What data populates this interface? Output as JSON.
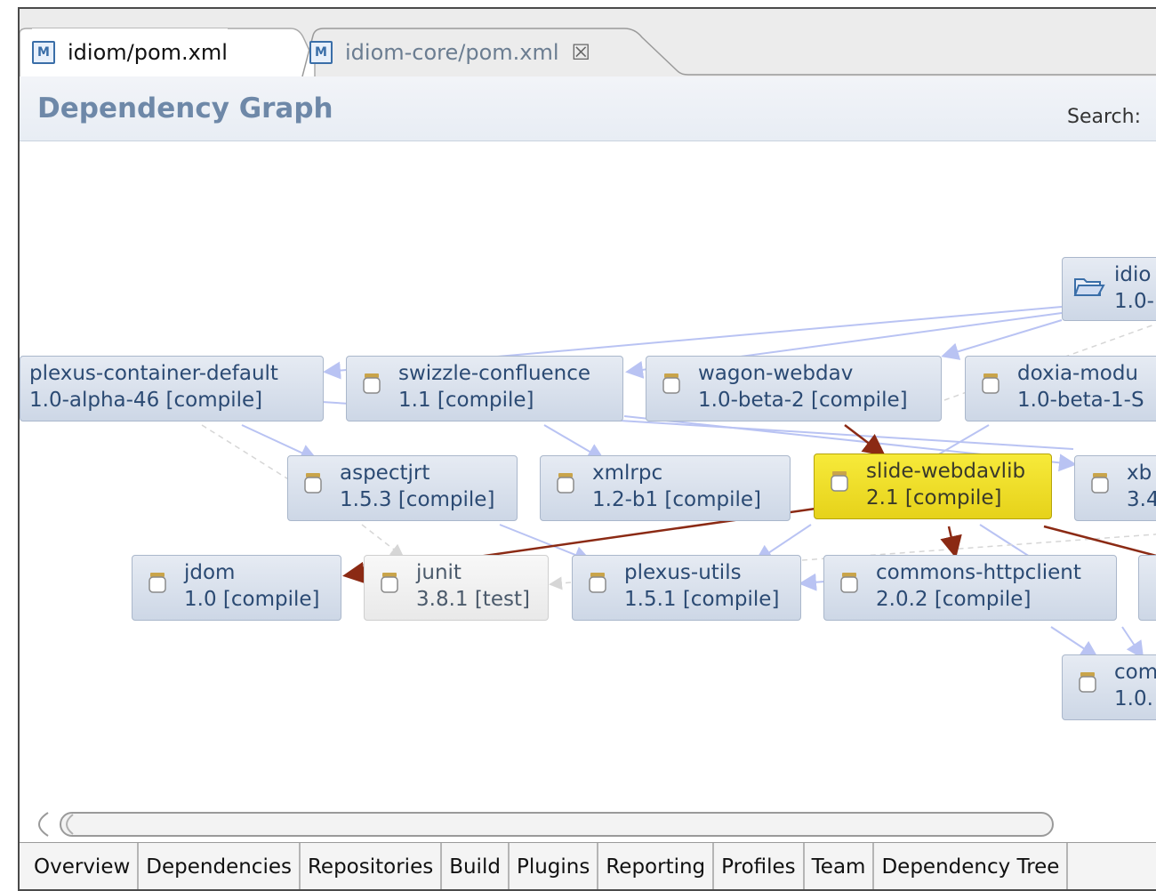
{
  "editor_tabs": [
    {
      "label": "idiom/pom.xml",
      "icon": "maven-pom-icon",
      "active": true
    },
    {
      "label": "idiom-core/pom.xml",
      "icon": "maven-pom-icon",
      "active": false,
      "close_icon": "close-icon"
    }
  ],
  "header": {
    "title": "Dependency Graph",
    "search_label": "Search:"
  },
  "graph": {
    "root_node": {
      "name": "idio",
      "version": "1.0-",
      "icon": "folder-open-icon"
    },
    "nodes": [
      {
        "name": "plexus-container-default",
        "version": "1.0-alpha-46 [compile]"
      },
      {
        "name": "swizzle-confluence",
        "version": "1.1 [compile]"
      },
      {
        "name": "wagon-webdav",
        "version": "1.0-beta-2 [compile]"
      },
      {
        "name": "doxia-modu",
        "version": "1.0-beta-1-S"
      },
      {
        "name": "aspectjrt",
        "version": "1.5.3 [compile]"
      },
      {
        "name": "xmlrpc",
        "version": "1.2-b1 [compile]"
      },
      {
        "name": "slide-webdavlib",
        "version": "2.1 [compile]",
        "highlighted": true
      },
      {
        "name": "xb",
        "version": "3.4"
      },
      {
        "name": "jdom",
        "version": "1.0 [compile]"
      },
      {
        "name": "junit",
        "version": "3.8.1 [test]"
      },
      {
        "name": "plexus-utils",
        "version": "1.5.1 [compile]"
      },
      {
        "name": "commons-httpclient",
        "version": "2.0.2 [compile]"
      },
      {
        "name": "com",
        "version": "1.0."
      }
    ],
    "colors": {
      "highlight_node": "#e6d21a",
      "selected_edge": "#8b2a14",
      "edge": "#b9c3f3",
      "dashed_edge": "#cccccc"
    }
  },
  "bottom_tabs": [
    "Overview",
    "Dependencies",
    "Repositories",
    "Build",
    "Plugins",
    "Reporting",
    "Profiles",
    "Team",
    "Dependency Tree"
  ]
}
